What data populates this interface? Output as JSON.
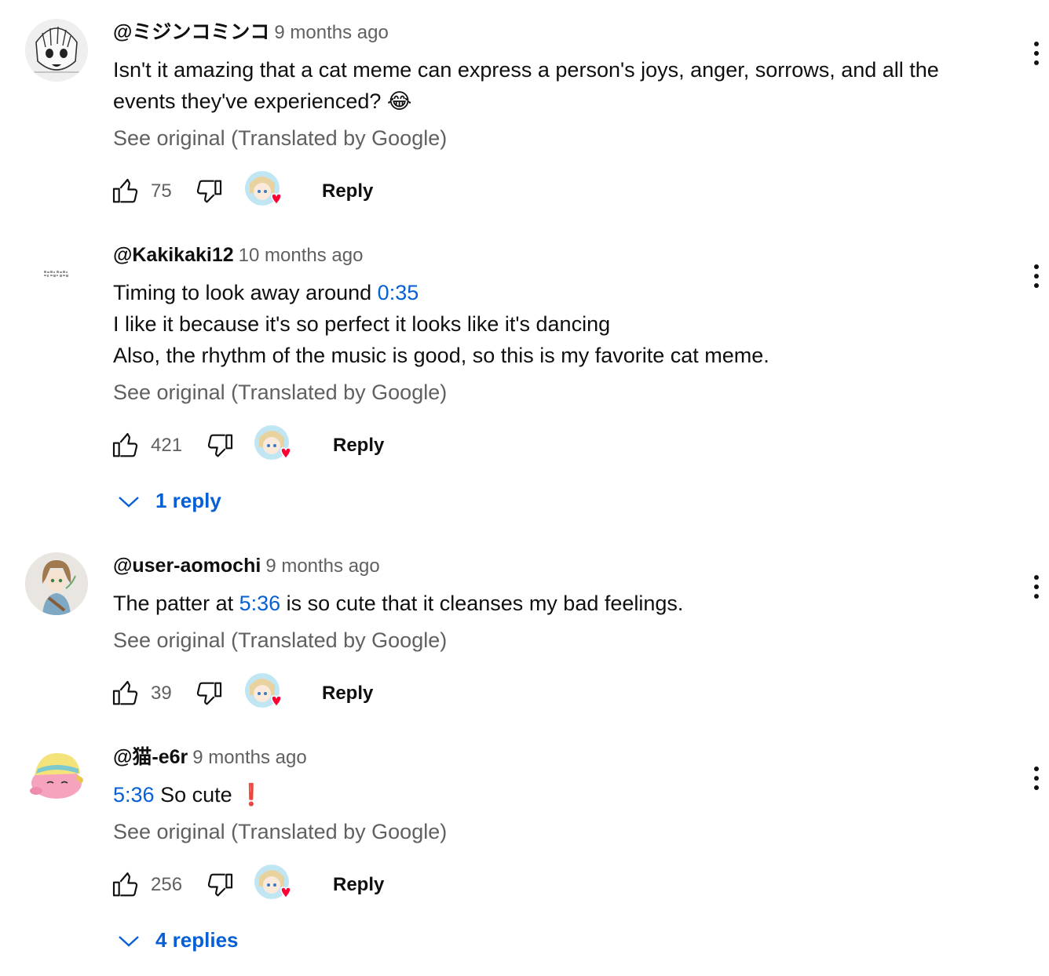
{
  "comments": [
    {
      "author": "@ミジンコミンコ",
      "time": "9 months ago",
      "lines": [
        [
          {
            "text": "Isn't it amazing that a cat meme can express a person's joys, anger, sorrows, and all the"
          }
        ],
        [
          {
            "text": "events they've experienced? 😂"
          }
        ]
      ],
      "translate": "See original (Translated by Google)",
      "likes": "75",
      "reply": "Reply",
      "avatar_icon": "sketch-face-icon"
    },
    {
      "author": "@Kakikaki12",
      "time": "10 months ago",
      "lines": [
        [
          {
            "text": "Timing to look away around "
          },
          {
            "text": "0:35",
            "link": true
          }
        ],
        [
          {
            "text": "I like it because it's so perfect it looks like it's dancing"
          }
        ],
        [
          {
            "text": "Also, the rhythm of the music is good, so this is my favorite cat meme."
          }
        ]
      ],
      "translate": "See original (Translated by Google)",
      "likes": "421",
      "reply": "Reply",
      "replies_label": "1 reply",
      "avatar_icon": "pixel-text-icon"
    },
    {
      "author": "@user-aomochi",
      "time": "9 months ago",
      "lines": [
        [
          {
            "text": "The patter at "
          },
          {
            "text": "5:36",
            "link": true
          },
          {
            "text": " is so cute that it cleanses my bad feelings."
          }
        ]
      ],
      "translate": "See original (Translated by Google)",
      "likes": "39",
      "reply": "Reply",
      "avatar_icon": "anime-character-icon"
    },
    {
      "author": "@猫-e6r",
      "time": "9 months ago",
      "lines": [
        [
          {
            "text": "5:36",
            "link": true
          },
          {
            "text": " So cute ❗"
          }
        ]
      ],
      "translate": "See original (Translated by Google)",
      "likes": "256",
      "reply": "Reply",
      "replies_label": "4 replies",
      "avatar_icon": "pink-kirby-icon"
    }
  ],
  "colors": {
    "link": "#065fd4",
    "secondary_text": "#606060",
    "heart": "#ff0033"
  }
}
